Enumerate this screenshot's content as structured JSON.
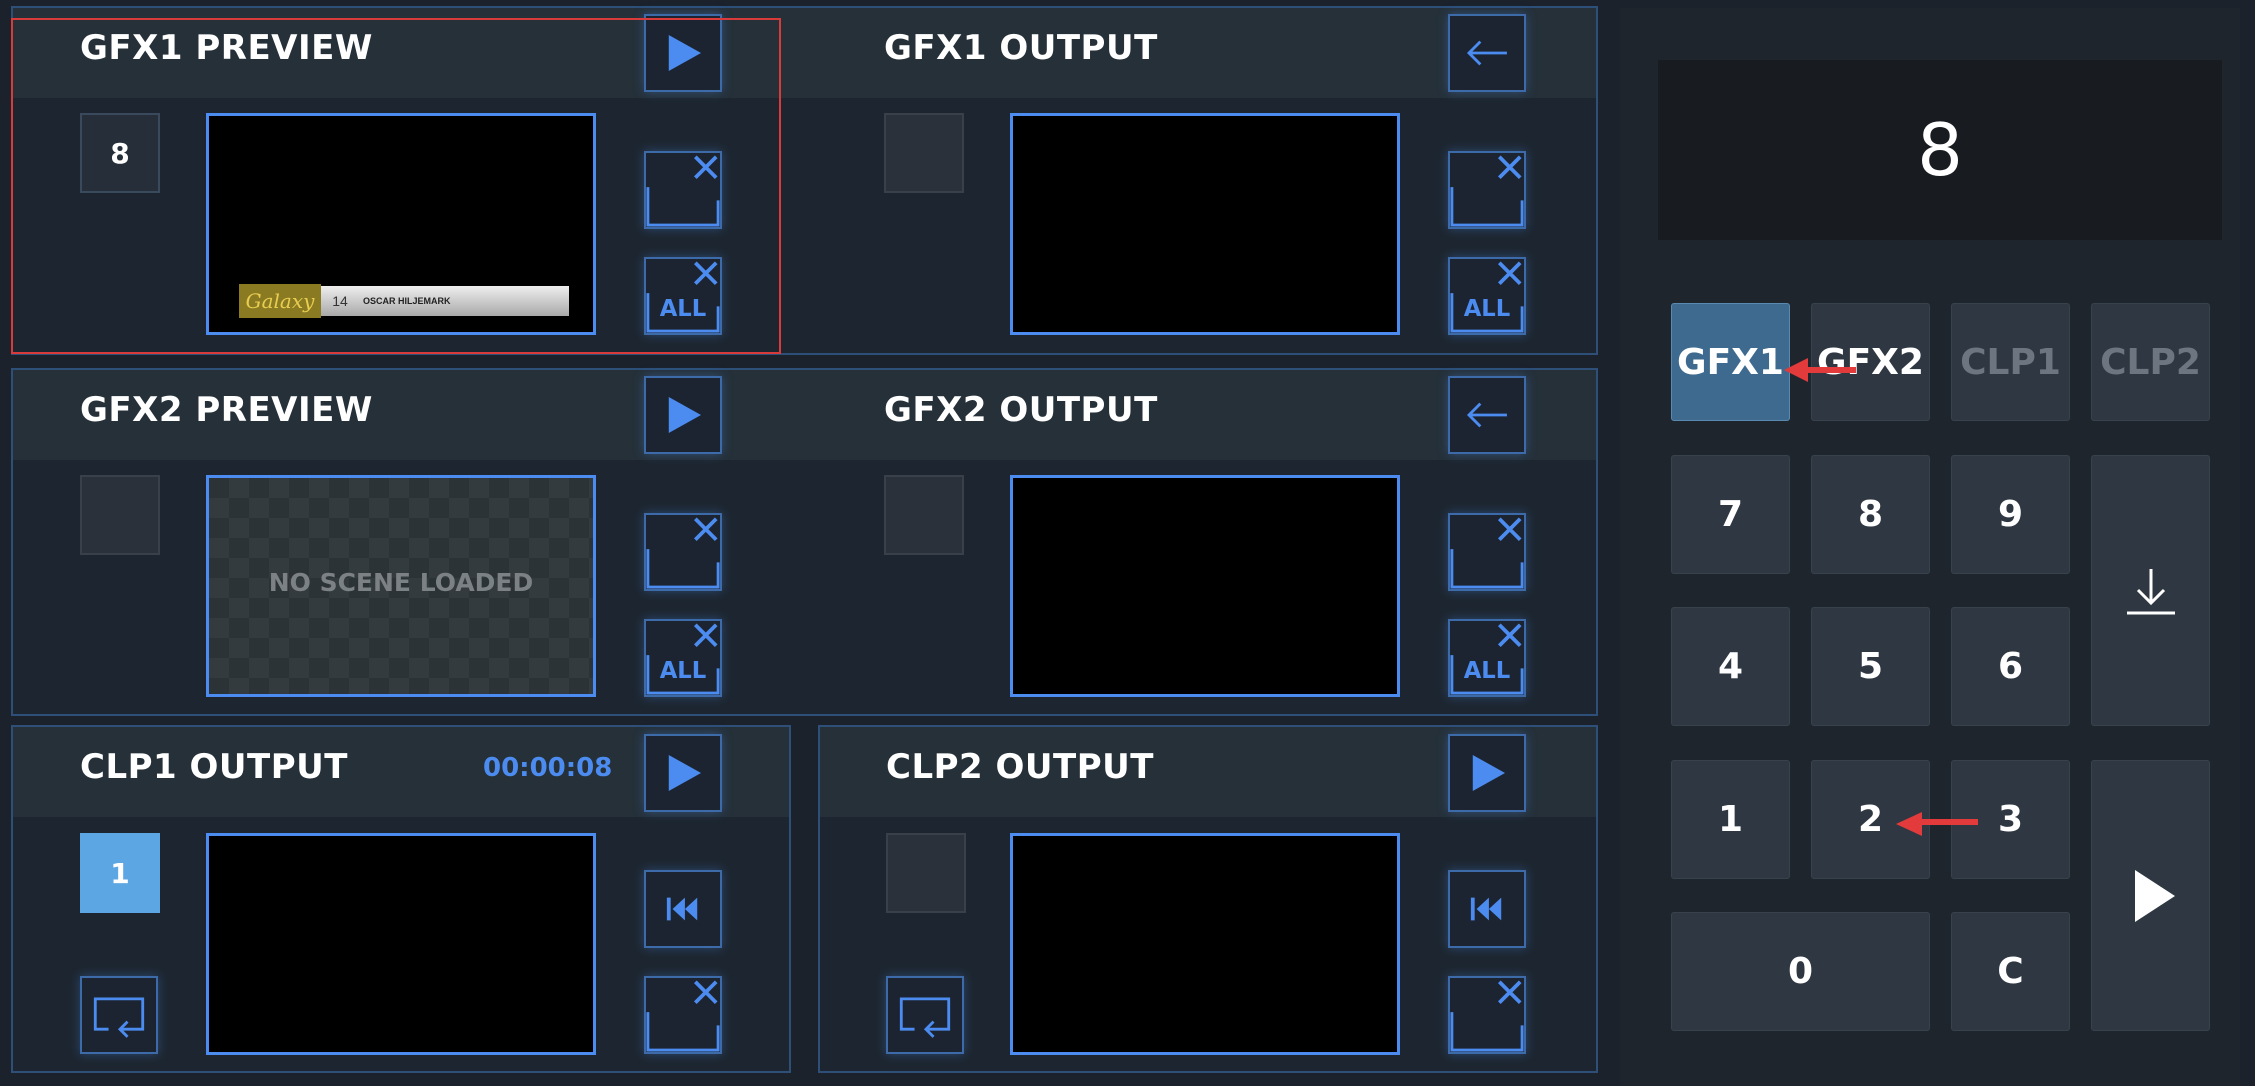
{
  "gfx1_preview": {
    "title": "GFX1 PREVIEW",
    "slot": "8",
    "lower_third": {
      "logo": "Galaxy",
      "number": "14",
      "name": "OSCAR HILJEMARK"
    }
  },
  "gfx1_output": {
    "title": "GFX1 OUTPUT"
  },
  "gfx2_preview": {
    "title": "GFX2 PREVIEW",
    "empty_text": "NO SCENE LOADED"
  },
  "gfx2_output": {
    "title": "GFX2 OUTPUT"
  },
  "clp1_output": {
    "title": "CLP1 OUTPUT",
    "timecode": "00:00:08",
    "slot": "1"
  },
  "clp2_output": {
    "title": "CLP2 OUTPUT"
  },
  "clear_all_label": "ALL",
  "keypad": {
    "display": "8",
    "channels": [
      "GFX1",
      "GFX2",
      "CLP1",
      "CLP2"
    ],
    "selected_channel": "GFX1",
    "digits": [
      "7",
      "8",
      "9",
      "4",
      "5",
      "6",
      "1",
      "2",
      "3",
      "0"
    ],
    "clear": "C"
  },
  "colors": {
    "accent": "#4c8cf0",
    "selected_key": "#3d6a8e",
    "active_slot": "#5da6e4",
    "highlight": "#d93a3a"
  }
}
